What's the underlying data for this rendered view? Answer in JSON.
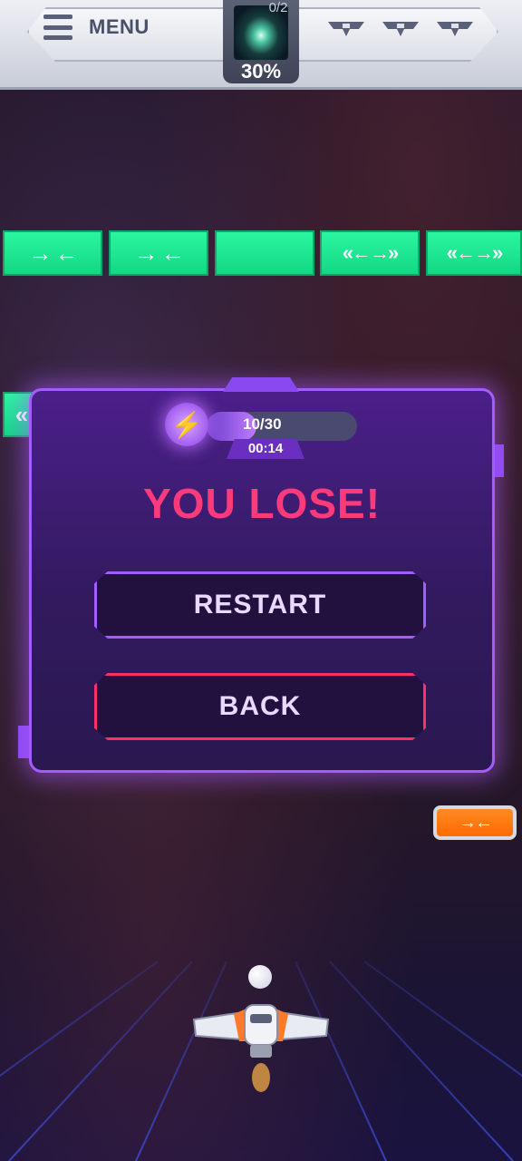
{
  "header": {
    "menu_label": "MENU",
    "level_counter": "0/2",
    "level_progress_text": "30%",
    "level_progress": 0.3,
    "lives": 3
  },
  "bricks": {
    "row1": [
      {
        "label": "→ ←",
        "color": "#20e58f"
      },
      {
        "label": "→ ←",
        "color": "#20e58f"
      },
      {
        "label": "",
        "color": "#20e58f"
      },
      {
        "label": "«←→»",
        "color": "#20e58f"
      },
      {
        "label": "«←→»",
        "color": "#20e58f"
      }
    ],
    "partial_left": {
      "label": "«",
      "color": "#20e58f"
    },
    "orange_capsule": {
      "label": "→←",
      "color": "#ff6a00"
    }
  },
  "modal": {
    "progress_text": "10/30",
    "progress": 0.3333,
    "timer": "00:14",
    "title": "YOU LOSE!",
    "restart_label": "RESTART",
    "back_label": "BACK",
    "accent_color": "#a45cff",
    "title_color": "#ff3a7a"
  }
}
